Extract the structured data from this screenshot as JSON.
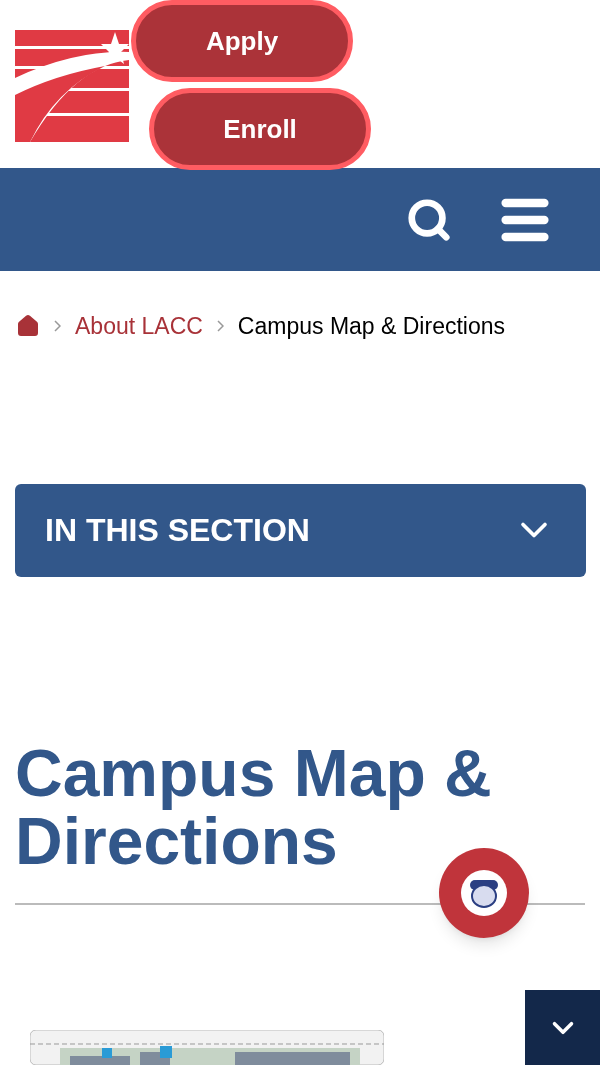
{
  "header": {
    "buttons": [
      {
        "label": "Apply"
      },
      {
        "label": "Enroll"
      }
    ]
  },
  "breadcrumb": [
    {
      "label": "About LACC",
      "kind": "link"
    },
    {
      "label": "Campus Map & Directions",
      "kind": "current"
    }
  ],
  "section_menu": {
    "label": "IN THIS SECTION",
    "expanded": false
  },
  "page_title": "Campus Map & Directions"
}
